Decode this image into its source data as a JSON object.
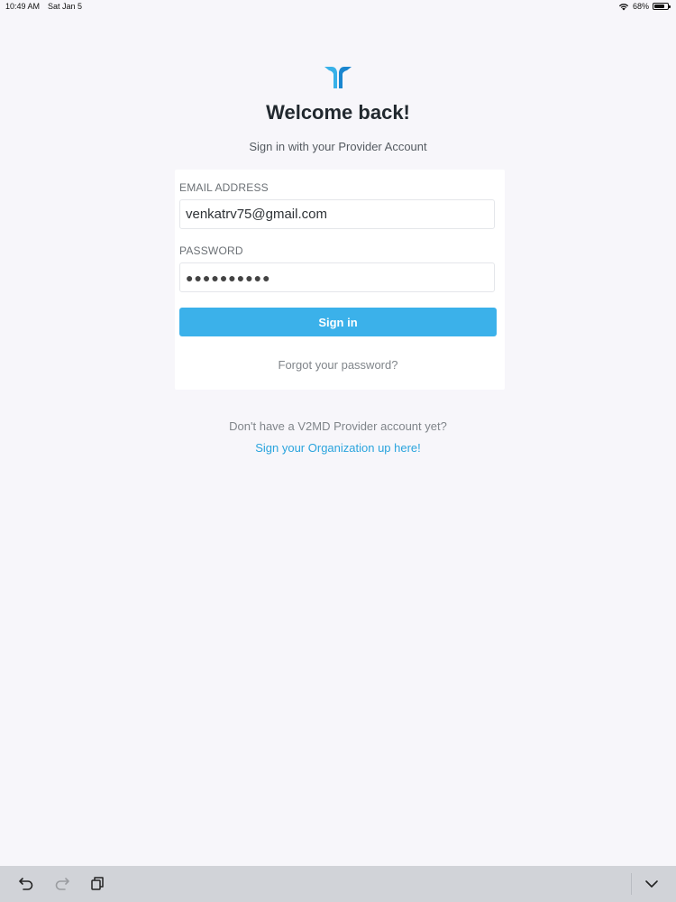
{
  "status_bar": {
    "time": "10:49 AM",
    "date": "Sat Jan 5",
    "battery": "68%",
    "icons": [
      "wifi-icon",
      "battery-icon"
    ]
  },
  "logo": {
    "icon": "brand-logo-icon",
    "colors": {
      "left": "#38b1e8",
      "right": "#1a86cf"
    }
  },
  "heading": {
    "title": "Welcome back!",
    "subtitle": "Sign in with your Provider Account"
  },
  "form": {
    "email_label": "EMAIL ADDRESS",
    "email_value": "venkatrv75@gmail.com",
    "password_label": "PASSWORD",
    "password_value": "●●●●●●●●●●",
    "signin_label": "Sign in",
    "forgot_label": "Forgot your password?"
  },
  "signup": {
    "prompt": "Don't have a V2MD Provider account yet?",
    "link_label": "Sign your Organization up here!"
  },
  "toolbar": {
    "icons": [
      "undo-icon",
      "redo-icon",
      "clipboard-icon",
      "chevron-down-icon"
    ]
  },
  "colors": {
    "accent": "#3bb1ea",
    "link": "#2aa4dd",
    "background": "#f7f6fa"
  }
}
